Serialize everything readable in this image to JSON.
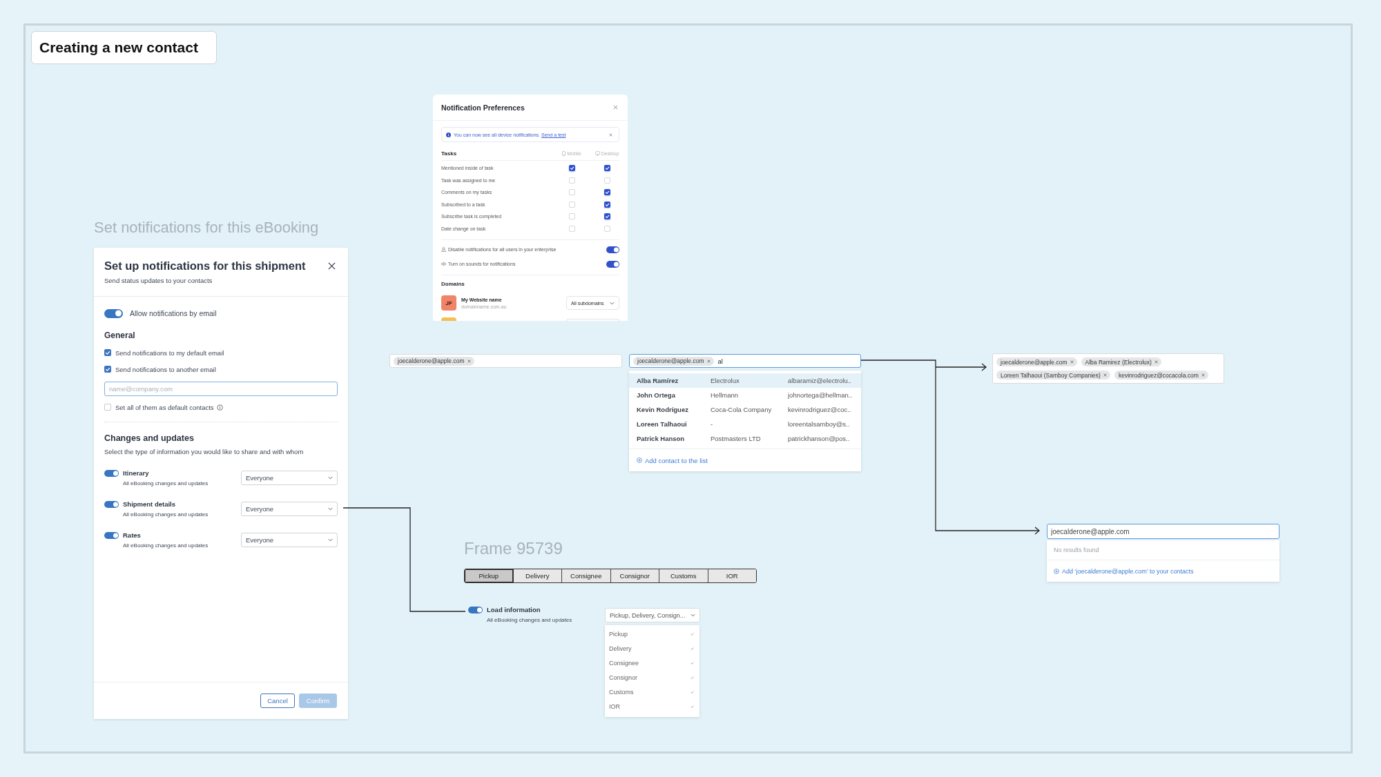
{
  "board": {
    "title": "Creating a new contact"
  },
  "shipment_dialog": {
    "caption": "Set notifications for this eBooking",
    "title": "Set up notifications for this shipment",
    "subtitle": "Send status updates to your contacts",
    "email_toggle": {
      "label": "Allow notifications by email",
      "on": true
    },
    "general": {
      "heading": "General",
      "options": [
        {
          "label": "Send notifications to my default email",
          "checked": true
        },
        {
          "label": "Send notifications to another email",
          "checked": true
        }
      ],
      "email_field": {
        "placeholder": "name@company.com"
      },
      "default_contacts": {
        "label": "Set all of them as default contacts",
        "checked": false
      }
    },
    "changes": {
      "heading": "Changes and updates",
      "description": "Select the type of information you would like to share and with whom",
      "items": [
        {
          "label": "Itinerary",
          "detail": "All eBooking changes and updates",
          "on": true,
          "audience": "Everyone"
        },
        {
          "label": "Shipment details",
          "detail": "All eBooking changes and updates",
          "on": true,
          "audience": "Everyone"
        },
        {
          "label": "Rates",
          "detail": "All eBooking changes and updates",
          "on": true,
          "audience": "Everyone"
        }
      ]
    },
    "buttons": [
      {
        "label": "Cancel",
        "kind": "secondary",
        "disabled": false
      },
      {
        "label": "Confirm",
        "kind": "primary",
        "disabled": true
      }
    ]
  },
  "notification_preferences": {
    "title": "Notification Preferences",
    "banner": {
      "text": "You can now see all device notifications.",
      "link": "Send a test"
    },
    "tasks": {
      "heading": "Tasks",
      "columns": [
        "Mobile",
        "Desktop"
      ],
      "rows": [
        {
          "label": "Mentioned inside of task",
          "mobile": true,
          "desktop": true
        },
        {
          "label": "Task was assigned to me",
          "mobile": false,
          "desktop": false
        },
        {
          "label": "Comments on my tasks",
          "mobile": false,
          "desktop": true
        },
        {
          "label": "Subscribed to a task",
          "mobile": false,
          "desktop": true
        },
        {
          "label": "Subscribe task is completed",
          "mobile": false,
          "desktop": true
        },
        {
          "label": "Date change on task",
          "mobile": false,
          "desktop": false
        }
      ]
    },
    "switches": [
      {
        "label": "Disable notifications for all users in your enterprise",
        "on": true
      },
      {
        "label": "Turn on sounds for notifications",
        "on": true
      }
    ],
    "domains": {
      "heading": "Domains",
      "items": [
        {
          "logo": "JF",
          "name": "My Website name",
          "address": "domainname.com.au",
          "scope": "All subdomains"
        }
      ]
    }
  },
  "recipient_field": {
    "chips": [
      "joecalderone@apple.com"
    ]
  },
  "contact_search": {
    "chips": [
      "joecalderone@apple.com"
    ],
    "value": "al",
    "results": [
      {
        "name": "Alba Ramírez",
        "company": "Electrolux",
        "email": "albaramiz@electrolu..",
        "selected": true
      },
      {
        "name": "John Ortega",
        "company": "Hellmann",
        "email": "johnortega@hellman..",
        "selected": false
      },
      {
        "name": "Kevin Rodríguez",
        "company": "Coca-Cola Company",
        "email": "kevinrodriguez@coc..",
        "selected": false
      },
      {
        "name": "Loreen Talhaoui",
        "company": "-",
        "email": "loreentalsamboy@s..",
        "selected": false
      },
      {
        "name": "Patrick Hanson",
        "company": "Postmasters LTD",
        "email": "patrickhanson@pos..",
        "selected": false
      }
    ],
    "add_action": "Add contact to the list"
  },
  "selected_contacts": {
    "chips": [
      "joecalderone@apple.com",
      "Alba Ramirez (Electrolux)",
      "Loreen Talhaoui (Samboy Companies)",
      "kevinrodriguez@cocacola.com"
    ]
  },
  "new_contact": {
    "value": "joecalderone@apple.com",
    "message": "No results found",
    "add_action": "Add ‘joecalderone@apple.com’ to your contacts"
  },
  "frame": {
    "title": "Frame 95739",
    "tabs": [
      {
        "label": "Pickup",
        "selected": true
      },
      {
        "label": "Delivery",
        "selected": false
      },
      {
        "label": "Consignee",
        "selected": false
      },
      {
        "label": "Consignor",
        "selected": false
      },
      {
        "label": "Customs",
        "selected": false
      },
      {
        "label": "IOR",
        "selected": false
      }
    ],
    "toggle": {
      "label": "Load information",
      "detail": "All eBooking changes and updates",
      "on": true
    },
    "select": {
      "value": "Pickup, Delivery, Consign...",
      "options": [
        {
          "label": "Pickup",
          "checked": true
        },
        {
          "label": "Delivery",
          "checked": true
        },
        {
          "label": "Consignee",
          "checked": true
        },
        {
          "label": "Consignor",
          "checked": true
        },
        {
          "label": "Customs",
          "checked": true
        },
        {
          "label": "IOR",
          "checked": true
        }
      ]
    }
  }
}
